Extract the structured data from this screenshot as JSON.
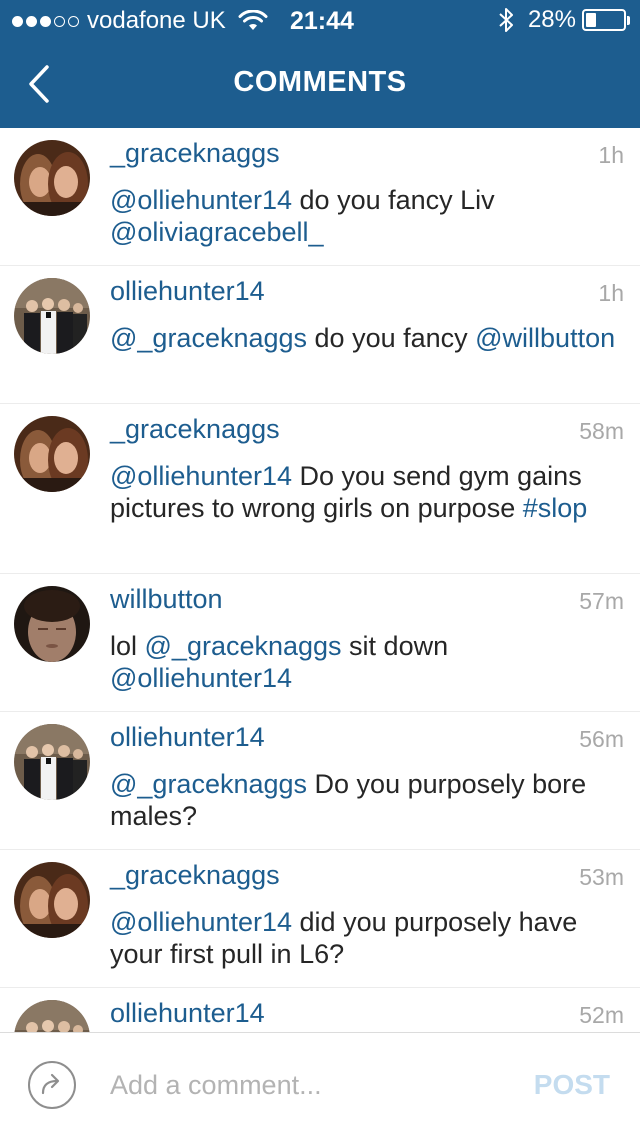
{
  "status_bar": {
    "signal_dots_filled": 3,
    "signal_dots_total": 5,
    "carrier": "vodafone UK",
    "time": "21:44",
    "battery_pct_label": "28%",
    "battery_level": 0.28
  },
  "nav": {
    "title": "COMMENTS",
    "back_icon": "chevron-left-icon"
  },
  "comments": [
    {
      "username": "_graceknaggs",
      "time": "1h",
      "avatar": "grace",
      "text": [
        {
          "t": "@olliehunter14",
          "mention": true
        },
        {
          "t": " do you fancy Liv ",
          "mention": false
        },
        {
          "t": "@oliviagracebell_",
          "mention": true
        }
      ]
    },
    {
      "username": "olliehunter14",
      "time": "1h",
      "avatar": "ollie",
      "text": [
        {
          "t": "@_graceknaggs",
          "mention": true
        },
        {
          "t": " do you fancy ",
          "mention": false
        },
        {
          "t": "@willbutton",
          "mention": true
        }
      ]
    },
    {
      "username": "_graceknaggs",
      "time": "58m",
      "avatar": "grace",
      "text": [
        {
          "t": "@olliehunter14",
          "mention": true
        },
        {
          "t": " Do you send gym gains pictures to wrong girls on purpose ",
          "mention": false
        },
        {
          "t": "#slop",
          "mention": true
        }
      ]
    },
    {
      "username": "willbutton",
      "time": "57m",
      "avatar": "will",
      "text": [
        {
          "t": "lol ",
          "mention": false
        },
        {
          "t": "@_graceknaggs",
          "mention": true
        },
        {
          "t": " sit down ",
          "mention": false
        },
        {
          "t": "@olliehunter14",
          "mention": true
        }
      ]
    },
    {
      "username": "olliehunter14",
      "time": "56m",
      "avatar": "ollie",
      "text": [
        {
          "t": "@_graceknaggs",
          "mention": true
        },
        {
          "t": " Do you purposely bore males?",
          "mention": false
        }
      ]
    },
    {
      "username": "_graceknaggs",
      "time": "53m",
      "avatar": "grace",
      "text": [
        {
          "t": "@olliehunter14",
          "mention": true
        },
        {
          "t": " did you purposely have your first pull in L6?",
          "mention": false
        }
      ]
    },
    {
      "username": "olliehunter14",
      "time": "52m",
      "avatar": "ollie",
      "text": []
    }
  ],
  "footer": {
    "share_icon": "share-arrow-icon",
    "input_placeholder": "Add a comment...",
    "input_value": "",
    "post_label": "POST"
  },
  "colors": {
    "header_bg": "#1d5d8f",
    "link": "#1d5d8f",
    "timestamp": "#a8a8a8",
    "post_disabled": "#c4dcef"
  }
}
